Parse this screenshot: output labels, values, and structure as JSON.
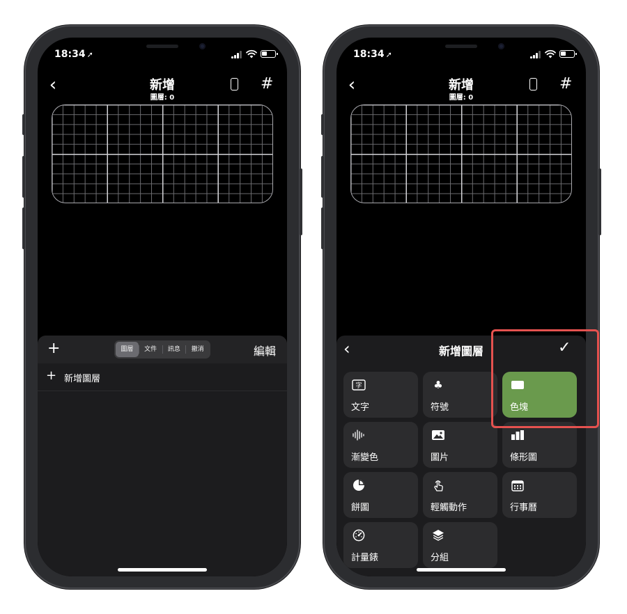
{
  "status_bar": {
    "time": "18:34",
    "location_arrow": "➚"
  },
  "nav": {
    "title": "新增",
    "subtitle": "圖層: 0",
    "back_glyph": "‹",
    "grid_glyph": "#"
  },
  "left_panel": {
    "plus_glyph": "+",
    "segments": [
      "圖層",
      "文件",
      "訊息",
      "撤消"
    ],
    "active_segment": "圖層",
    "edit_label": "編輯",
    "add_layer_label": "新增圖層"
  },
  "right_panel": {
    "title": "新增圖層",
    "check_glyph": "✓",
    "tiles": [
      {
        "label": "文字",
        "icon": "text-box-icon"
      },
      {
        "label": "符號",
        "icon": "club-icon"
      },
      {
        "label": "色塊",
        "icon": "color-block-icon",
        "selected": true
      },
      {
        "label": "漸變色",
        "icon": "waveform-icon"
      },
      {
        "label": "圖片",
        "icon": "photo-icon"
      },
      {
        "label": "條形圖",
        "icon": "bar-chart-icon"
      },
      {
        "label": "餅圖",
        "icon": "pie-chart-icon"
      },
      {
        "label": "輕觸動作",
        "icon": "tap-hand-icon"
      },
      {
        "label": "行事曆",
        "icon": "calendar-icon"
      },
      {
        "label": "計量錶",
        "icon": "gauge-icon"
      },
      {
        "label": "分組",
        "icon": "layers-icon"
      }
    ]
  },
  "colors": {
    "selected_tile": "#6a9a4d",
    "highlight": "#e5524f"
  }
}
